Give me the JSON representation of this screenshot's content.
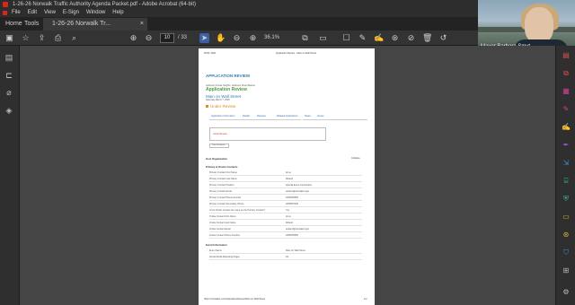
{
  "window": {
    "title": "1-26-26 Norwalk Traffic Authority Agenda Packet.pdf - Adobe Acrobat (64-bit)"
  },
  "menu": [
    "File",
    "Edit",
    "View",
    "E-Sign",
    "Window",
    "Help"
  ],
  "tabs": {
    "home": "Home",
    "tools": "Tools",
    "document": "1-26-26 Norwalk Tr..."
  },
  "toolbar": {
    "page_current": "10",
    "page_total": "/ 33",
    "zoom": "36.1%"
  },
  "video": {
    "participant": "Mayor Barbara Smyt..."
  },
  "page": {
    "header_left": "ROW: 2026",
    "header_center": "Application Review - Main on Wall Street",
    "title": "APPLICATION REVIEW",
    "org_line": "Jefferson Creole Heights, Jefferson Street Market",
    "subtitle": "Application Review",
    "event_name": "Main on Wall Street",
    "event_date": "Saturday March 7, 2026",
    "status": "Under Review",
    "tabs": [
      "Application Information",
      "Details",
      "Reviews",
      "Related Applications",
      "Notes",
      "Issues"
    ],
    "status_box_label": "Under Review",
    "small_button": "View Guidance",
    "section_host": "Host Organization",
    "section_host_right": "Collapse",
    "section_contact": "Primary & Onsite Contacts",
    "contact_rows": [
      {
        "k": "Primary Contact First Name",
        "v": "Anne"
      },
      {
        "k": "Primary Contact Last Name",
        "v": "Roland"
      },
      {
        "k": "Primary Contact Position",
        "v": "Special Event Coordinator"
      },
      {
        "k": "Primary Contact Email",
        "v": "aroland@norwalkct.gov"
      },
      {
        "k": "Primary Contact Phone Number",
        "v": "2035555555"
      },
      {
        "k": "Primary Contact Secondary Phone",
        "v": "2035567546"
      },
      {
        "k": "Is the Onsite Contact the same as the Primary Contact?",
        "v": "Yes"
      },
      {
        "k": "Onsite Contact First Name",
        "v": "Anne"
      },
      {
        "k": "Onsite Contact Last Name",
        "v": "Roland"
      },
      {
        "k": "Onsite Contact Email",
        "v": "aroland@norwalkct.gov"
      },
      {
        "k": "Onsite Contact Phone Number",
        "v": "2035555555"
      }
    ],
    "section_event": "Event Information",
    "event_rows": [
      {
        "k": "Event Name",
        "v": "Main on Wall Street"
      },
      {
        "k": "Social Media Marketing Pages",
        "v": "No"
      }
    ],
    "footer": "https://norwalkct.com/Application/Review/Main-on-Wall-Street",
    "footer_page": "1/2"
  }
}
